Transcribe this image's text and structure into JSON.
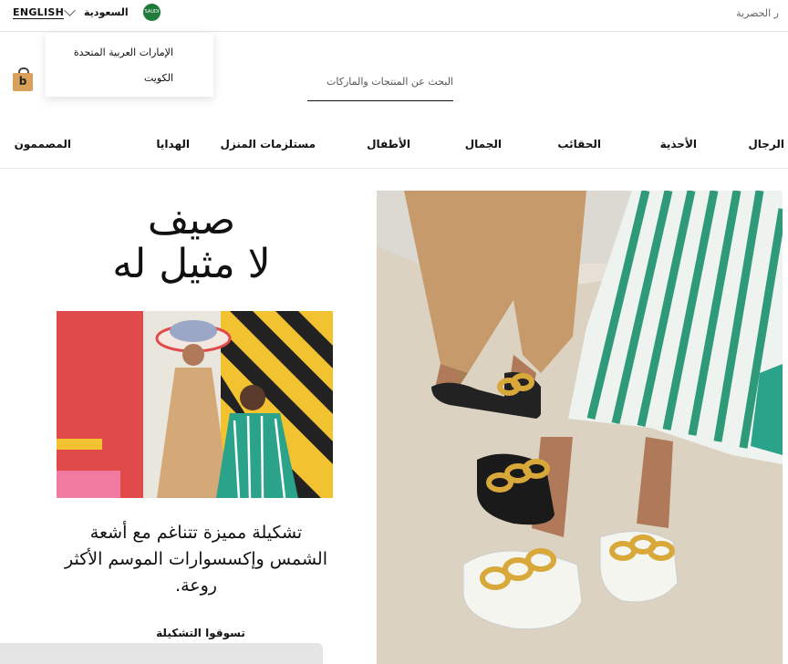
{
  "header": {
    "language_label": "ENGLISH",
    "country_label": "السعودية",
    "flag_text": "SAUDI",
    "exclusive_label": "ر الحصرية"
  },
  "country_dropdown": {
    "items": [
      "الإمارات العربية المتحدة",
      "الكويت"
    ]
  },
  "cart": {
    "icon": "bag-icon",
    "letter": "b",
    "color": "#d9a05b"
  },
  "search": {
    "placeholder": "البحث عن المنتجات والماركات"
  },
  "nav": {
    "items": [
      "الرجال",
      "الأحذية",
      "الحقائب",
      "الجمال",
      "الأطفال",
      "مستلزمات المنزل",
      "الهدايا",
      "المصممون"
    ]
  },
  "promo": {
    "headline_line1": "صيف",
    "headline_line2": "لا مثيل له",
    "description": "تشكيلة مميزة تتناغم مع أشعة الشمس وإكسسوارات الموسم الأكثر روعة.",
    "cta": "تسوقوا التشكيلة"
  },
  "colors": {
    "accent": "#111111",
    "border": "#e6e6e6",
    "bag": "#d9a05b",
    "flag": "#1e7b3a"
  }
}
